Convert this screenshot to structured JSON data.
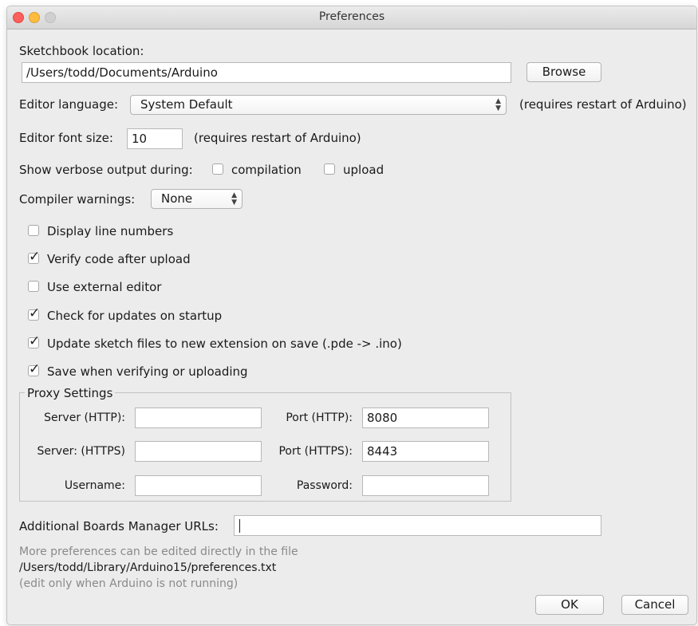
{
  "window": {
    "title": "Preferences"
  },
  "sketchbook": {
    "label": "Sketchbook location:",
    "path": "/Users/todd/Documents/Arduino",
    "browse_label": "Browse"
  },
  "editor_language": {
    "label": "Editor language:",
    "value": "System Default",
    "note": "(requires restart of Arduino)"
  },
  "editor_font_size": {
    "label": "Editor font size:",
    "value": "10",
    "note": "(requires restart of Arduino)"
  },
  "verbose_output": {
    "label": "Show verbose output during:",
    "options": [
      {
        "label": "compilation",
        "checked": false
      },
      {
        "label": "upload",
        "checked": false
      }
    ]
  },
  "compiler_warnings": {
    "label": "Compiler warnings:",
    "value": "None"
  },
  "checkboxes": [
    {
      "label": "Display line numbers",
      "checked": false
    },
    {
      "label": "Verify code after upload",
      "checked": true
    },
    {
      "label": "Use external editor",
      "checked": false
    },
    {
      "label": "Check for updates on startup",
      "checked": true
    },
    {
      "label": "Update sketch files to new extension on save (.pde -> .ino)",
      "checked": true
    },
    {
      "label": "Save when verifying or uploading",
      "checked": true
    }
  ],
  "proxy": {
    "title": "Proxy Settings",
    "server_http_label": "Server (HTTP):",
    "server_http_value": "",
    "port_http_label": "Port (HTTP):",
    "port_http_value": "8080",
    "server_https_label": "Server: (HTTPS)",
    "server_https_value": "",
    "port_https_label": "Port (HTTPS):",
    "port_https_value": "8443",
    "username_label": "Username:",
    "username_value": "",
    "password_label": "Password:",
    "password_value": ""
  },
  "boards_manager": {
    "label": "Additional Boards Manager URLs:",
    "value": ""
  },
  "footer": {
    "info_line1": "More preferences can be edited directly in the file",
    "file_path": "/Users/todd/Library/Arduino15/preferences.txt",
    "info_line3": "(edit only when Arduino is not running)",
    "ok_label": "OK",
    "cancel_label": "Cancel"
  }
}
